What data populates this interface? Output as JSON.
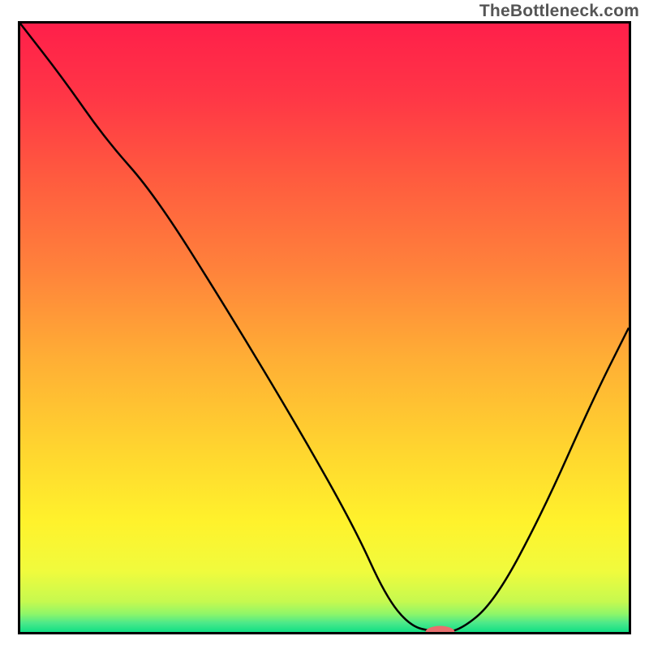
{
  "watermark": {
    "text": "TheBottleneck.com"
  },
  "colors": {
    "curve": "#000000",
    "marker_fill": "#e96f6e",
    "border": "#000000",
    "gradient_stops": [
      {
        "offset": "0%",
        "color": "#ff1f4a"
      },
      {
        "offset": "12%",
        "color": "#ff3646"
      },
      {
        "offset": "25%",
        "color": "#ff5a3f"
      },
      {
        "offset": "40%",
        "color": "#ff813b"
      },
      {
        "offset": "55%",
        "color": "#ffae35"
      },
      {
        "offset": "70%",
        "color": "#ffd52f"
      },
      {
        "offset": "82%",
        "color": "#fff22c"
      },
      {
        "offset": "90%",
        "color": "#f0fb3d"
      },
      {
        "offset": "95%",
        "color": "#c6f94f"
      },
      {
        "offset": "97%",
        "color": "#90f668"
      },
      {
        "offset": "98.5%",
        "color": "#4de98a"
      },
      {
        "offset": "100%",
        "color": "#11df84"
      }
    ]
  },
  "chart_data": {
    "type": "line",
    "title": "",
    "xlabel": "",
    "ylabel": "",
    "xlim": [
      0,
      100
    ],
    "ylim": [
      0,
      100
    ],
    "x": [
      0,
      7,
      14,
      22,
      34,
      46,
      55,
      60,
      64,
      68,
      72,
      78,
      86,
      94,
      100
    ],
    "values": [
      100,
      91,
      81,
      72,
      53,
      33,
      17,
      6,
      1,
      0,
      0,
      5,
      20,
      38,
      50
    ],
    "marker": {
      "x": 69,
      "y": 0,
      "rx": 2.4,
      "ry": 1.0
    },
    "legend": []
  }
}
